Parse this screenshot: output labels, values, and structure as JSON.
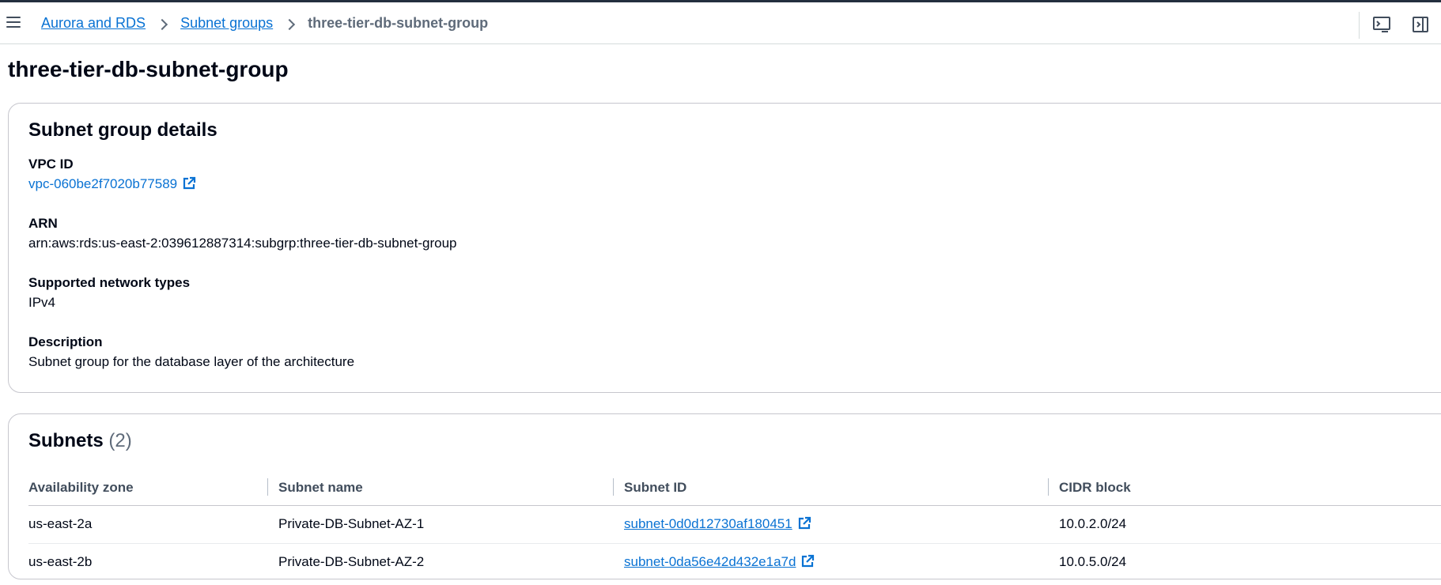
{
  "breadcrumb": {
    "items": [
      "Aurora and RDS",
      "Subnet groups"
    ],
    "current": "three-tier-db-subnet-group"
  },
  "page": {
    "title": "three-tier-db-subnet-group"
  },
  "details": {
    "heading": "Subnet group details",
    "vpc_id": {
      "label": "VPC ID",
      "value": "vpc-060be2f7020b77589"
    },
    "arn": {
      "label": "ARN",
      "value": "arn:aws:rds:us-east-2:039612887314:subgrp:three-tier-db-subnet-group"
    },
    "network_types": {
      "label": "Supported network types",
      "value": "IPv4"
    },
    "description": {
      "label": "Description",
      "value": "Subnet group for the database layer of the architecture"
    }
  },
  "subnets": {
    "heading": "Subnets",
    "count": "(2)",
    "columns": [
      "Availability zone",
      "Subnet name",
      "Subnet ID",
      "CIDR block"
    ],
    "rows": [
      {
        "az": "us-east-2a",
        "name": "Private-DB-Subnet-AZ-1",
        "id": "subnet-0d0d12730af180451",
        "cidr": "10.0.2.0/24"
      },
      {
        "az": "us-east-2b",
        "name": "Private-DB-Subnet-AZ-2",
        "id": "subnet-0da56e42d432e1a7d",
        "cidr": "10.0.5.0/24"
      }
    ]
  },
  "icons": {
    "menu": "hamburger-menu-icon",
    "breadcrumb_separator": "chevron-right-icon",
    "external_link": "external-link-icon",
    "cloudshell": "cloudshell-icon",
    "panel": "side-panel-icon"
  },
  "colors": {
    "link": "#0972d3",
    "text": "#000716",
    "muted": "#5f6b7a",
    "border": "#c6c6cd"
  }
}
